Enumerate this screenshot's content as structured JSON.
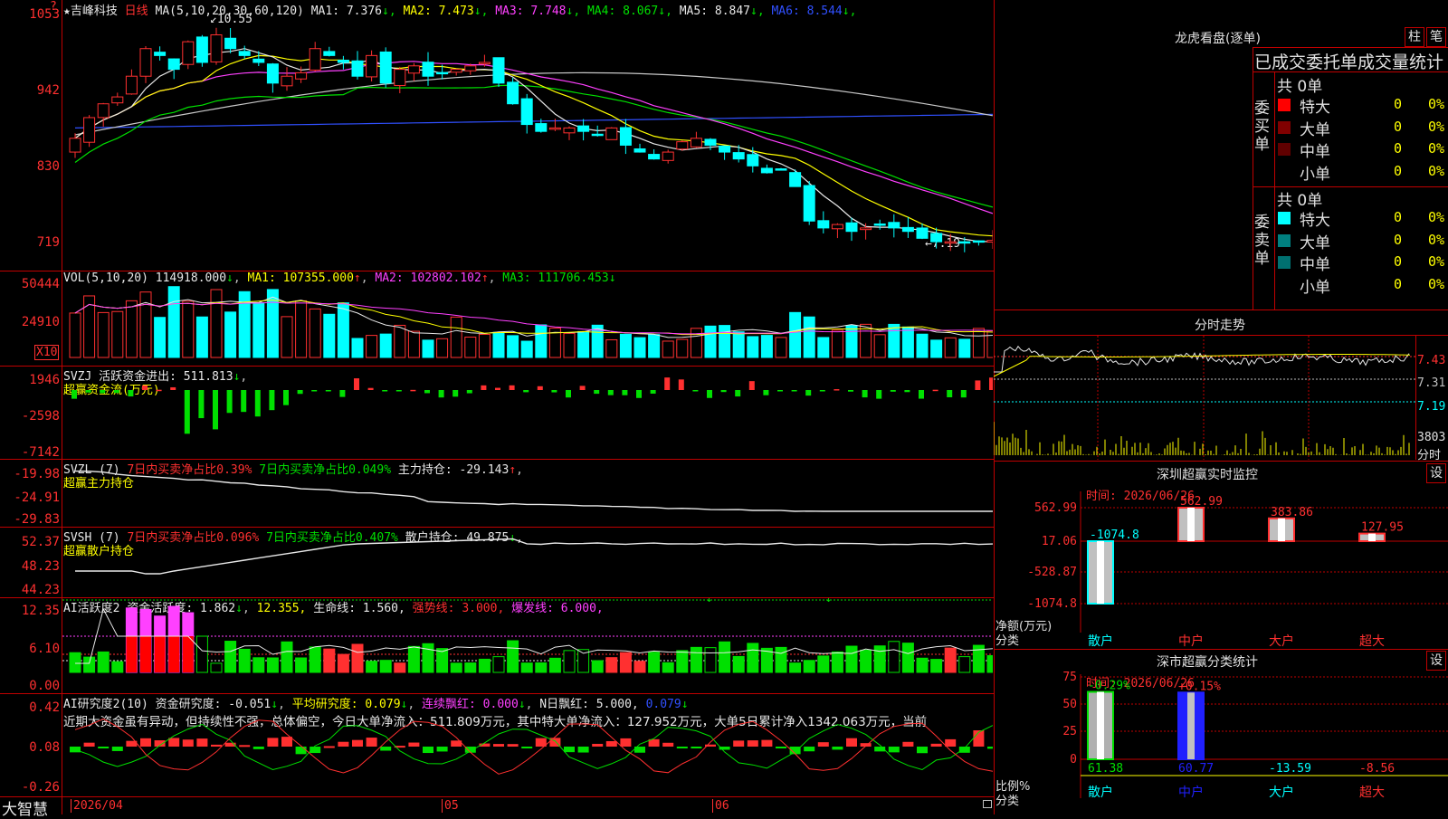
{
  "main_chart": {
    "title_star": "★",
    "stock_name": "吉峰科技",
    "period": "日线",
    "ma_params": "MA(5,10,20,30,60,120)",
    "ma_values": [
      {
        "label": "MA1: 7.376",
        "arrow": "↓",
        "color": "#e8e8e8"
      },
      {
        "label": "MA2: 7.473",
        "arrow": "↓",
        "color": "#ffff00"
      },
      {
        "label": "MA3: 7.748",
        "arrow": "↓",
        "color": "#ff40ff"
      },
      {
        "label": "MA4: 8.067",
        "arrow": "↓",
        "color": "#00e000"
      },
      {
        "label": "MA5: 8.847",
        "arrow": "↓",
        "color": "#e8e8e8"
      },
      {
        "label": "MA6: 8.544",
        "arrow": "↓",
        "color": "#3050ff"
      }
    ],
    "y_labels": [
      "1053",
      "942",
      "830",
      "719"
    ],
    "high_mark": "10.55",
    "low_mark": "7.19",
    "top_marker": "?"
  },
  "vol_panel": {
    "header": "VOL(5,10,20)",
    "value": "114918.000",
    "ma1": "MA1: 107355.000",
    "ma2": "MA2: 102802.102",
    "ma3": "MA3: 111706.453",
    "y_labels": [
      "50444",
      "24910"
    ],
    "unit": "X10"
  },
  "svzj_panel": {
    "header": "SVZJ  活跃资金进出: 511.813",
    "sub": "超赢资金流(万元)",
    "y_labels": [
      "1946",
      "-2598",
      "-7142"
    ]
  },
  "svzl_panel": {
    "name": "SVZL (7)",
    "a": "7日内买卖净占比0.39%",
    "b": "7日内买卖净占比0.049%",
    "c": "主力持仓: -29.143",
    "sub": "超赢主力持仓",
    "y_labels": [
      "-19.98",
      "-24.91",
      "-29.83"
    ]
  },
  "svsh_panel": {
    "name": "SVSH (7)",
    "a": "7日内买卖净占比0.096%",
    "b": "7日内买卖净占比0.407%",
    "c": "散户持仓: 49.875",
    "sub": "超赢散户持仓",
    "y_labels": [
      "52.37",
      "48.23",
      "44.23"
    ]
  },
  "ai_active_panel": {
    "name": "AI活跃度2",
    "a": "资金活跃度: 1.862",
    "b": "12.355,",
    "c": "生命线: 1.560,",
    "d": "强势线: 3.000,",
    "e": "爆发线: 6.000,",
    "y_labels": [
      "12.35",
      "6.10",
      "0.00"
    ]
  },
  "ai_research_panel": {
    "name": "AI研究度2(10)",
    "a": "资金研究度: -0.051",
    "b": "平均研究度: 0.079",
    "c": "连续飘红: 0.000",
    "d": "N日飘红: 5.000,",
    "e": "0.079",
    "comment": "近期大资金虽有异动，但持续性不强，总体偏空，今日大单净流入：511.809万元，其中特大单净流入：127.952万元，大单5日累计净入1342.063万元，当前",
    "y_labels": [
      "0.42",
      "0.08",
      "-0.26"
    ]
  },
  "bottom_axis": {
    "brand": "大智慧",
    "date_start": "2026/04",
    "m05": "05",
    "m06": "06"
  },
  "right_panel": {
    "lhkp_title": "龙虎看盘(逐单)",
    "btn_bar": "柱",
    "btn_pen": "笔",
    "stat_title": "已成交委托单成交量统计",
    "buy_label": "委买单",
    "sell_label": "委卖单",
    "buy_total": "共 0单",
    "sell_total": "共 0单",
    "buy_rows": [
      {
        "name": "特大",
        "count": "0",
        "pct": "0%",
        "color": "#ff0000"
      },
      {
        "name": "大单",
        "count": "0",
        "pct": "0%",
        "color": "#800000"
      },
      {
        "name": "中单",
        "count": "0",
        "pct": "0%",
        "color": "#600000"
      },
      {
        "name": "小单",
        "count": "0",
        "pct": "0%",
        "color": ""
      }
    ],
    "sell_rows": [
      {
        "name": "特大",
        "count": "0",
        "pct": "0%",
        "color": "#00ffff"
      },
      {
        "name": "大单",
        "count": "0",
        "pct": "0%",
        "color": "#008080"
      },
      {
        "name": "中单",
        "count": "0",
        "pct": "0%",
        "color": "#007070"
      },
      {
        "name": "小单",
        "count": "0",
        "pct": "0%",
        "color": ""
      }
    ],
    "intraday_title": "分时走势",
    "intraday_prices": [
      "7.43",
      "7.31",
      "7.19"
    ],
    "intraday_vol": "3803",
    "intraday_vol_label": "分时",
    "sz_monitor": {
      "title": "深圳超赢实时监控",
      "btn": "设",
      "time": "时间: 2026/06/26",
      "y_labels": [
        "562.99",
        "17.06",
        "-528.87",
        "-1074.8"
      ],
      "bars": [
        {
          "cat": "散户",
          "value": -1074.8,
          "label": "-1074.8"
        },
        {
          "cat": "中户",
          "value": 562.99,
          "label": "562.99"
        },
        {
          "cat": "大户",
          "value": 383.86,
          "label": "383.86"
        },
        {
          "cat": "超大",
          "value": 127.95,
          "label": "127.95"
        }
      ],
      "ylab1": "净额(万元)",
      "ylab2": "分类"
    },
    "sh_stats": {
      "title": "深市超赢分类统计",
      "btn": "设",
      "time": "时间: 2026/06/26",
      "y_labels": [
        "75",
        "50",
        "25",
        "0"
      ],
      "top_labels": [
        "-0.29%",
        "+0.15%"
      ],
      "bottom_values": [
        "61.38",
        "60.77",
        "-13.59",
        "-8.56"
      ],
      "cats": [
        "散户",
        "中户",
        "大户",
        "超大"
      ],
      "ylab1": "比例%",
      "ylab2": "分类"
    }
  }
}
